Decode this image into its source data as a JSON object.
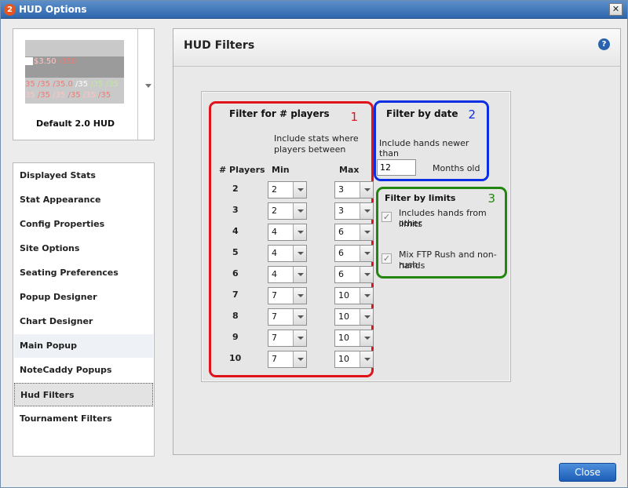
{
  "window": {
    "title": "HUD Options",
    "app_icon": "2",
    "close_glyph": "✕"
  },
  "preview": {
    "row1_a": "$3.50",
    "row1_b": "/350",
    "row2": [
      "35",
      "/35",
      "/35.0",
      "/35",
      "/35",
      "/35"
    ],
    "row3": [
      "35",
      "/35",
      "/35",
      "/35",
      "/35",
      "/35"
    ],
    "name": "Default 2.0 HUD"
  },
  "nav": {
    "items": [
      "Displayed Stats",
      "Stat Appearance",
      "Config Properties",
      "Site Options",
      "Seating Preferences",
      "Popup Designer",
      "Chart Designer",
      "Main Popup",
      "NoteCaddy Popups",
      "Hud Filters",
      "Tournament Filters"
    ],
    "active_index": 9,
    "hover_index": 7
  },
  "content": {
    "title": "HUD Filters",
    "help_glyph": "?"
  },
  "players_filter": {
    "title": "Filter for # players",
    "number": "1",
    "desc_line1": "Include stats where",
    "desc_line2": "players between",
    "col_players": "# Players",
    "col_min": "Min",
    "col_max": "Max",
    "rows": [
      {
        "players": "2",
        "min": "2",
        "max": "3"
      },
      {
        "players": "3",
        "min": "2",
        "max": "3"
      },
      {
        "players": "4",
        "min": "4",
        "max": "6"
      },
      {
        "players": "5",
        "min": "4",
        "max": "6"
      },
      {
        "players": "6",
        "min": "4",
        "max": "6"
      },
      {
        "players": "7",
        "min": "7",
        "max": "10"
      },
      {
        "players": "8",
        "min": "7",
        "max": "10"
      },
      {
        "players": "9",
        "min": "7",
        "max": "10"
      },
      {
        "players": "10",
        "min": "7",
        "max": "10"
      }
    ]
  },
  "date_filter": {
    "title": "Filter by date",
    "number": "2",
    "label": "Include hands newer than",
    "value": "12",
    "unit": "Months old"
  },
  "limits_filter": {
    "title": "Filter by limits",
    "number": "3",
    "opt1_line1": "Includes hands from other",
    "opt1_line2": "limits",
    "opt1_checked": true,
    "opt2_line1": "Mix FTP Rush and non-rush",
    "opt2_line2": "hands",
    "opt2_checked": true,
    "check_glyph": "✓"
  },
  "footer": {
    "close_label": "Close"
  }
}
